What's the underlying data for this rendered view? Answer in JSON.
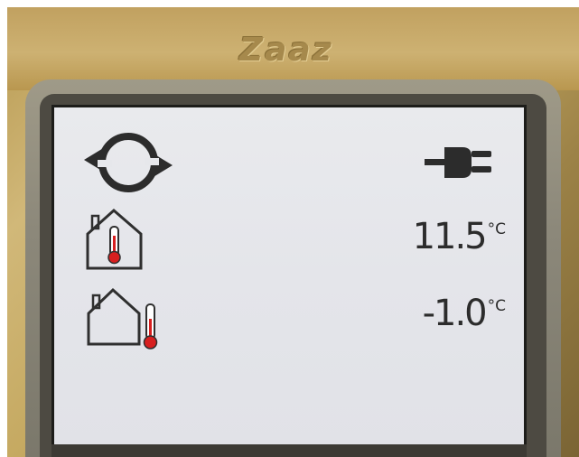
{
  "brand": {
    "logo_text": "Zaaz"
  },
  "status": {
    "mode_icon": "refresh-cycle-icon",
    "power_icon": "power-plug-icon"
  },
  "readings": {
    "indoor": {
      "icon": "indoor-temperature-icon",
      "value": "11.5",
      "unit": "°C"
    },
    "outdoor": {
      "icon": "outdoor-temperature-icon",
      "value": "-1.0",
      "unit": "°C"
    }
  },
  "colors": {
    "thermometer": "#d71f1f",
    "icon_outline": "#2f2f2f",
    "screen_bg": "#e6e7eb",
    "housing_gold": "#c5a961"
  }
}
